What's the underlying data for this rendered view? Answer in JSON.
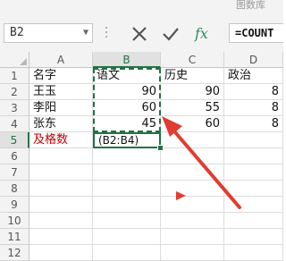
{
  "watermark": "图数库",
  "formula_bar": {
    "name_box": "B2",
    "cancel_icon": "cancel-icon",
    "enter_icon": "check-icon",
    "function_label": "fx",
    "formula_text": "=COUNT"
  },
  "columns": [
    "A",
    "B",
    "C",
    "D"
  ],
  "rows": [
    "1",
    "2",
    "3",
    "4",
    "5",
    "6",
    "7",
    "8",
    "9",
    "10",
    "11",
    "12"
  ],
  "table": {
    "headers": [
      "名字",
      "语文",
      "历史",
      "政治"
    ],
    "records": [
      {
        "name": "王玉",
        "chinese": "90",
        "history": "90",
        "politics": "8"
      },
      {
        "name": "李阳",
        "chinese": "60",
        "history": "55",
        "politics": "8"
      },
      {
        "name": "张东",
        "chinese": "45",
        "history": "60",
        "politics": "8"
      }
    ],
    "summary_label": "及格数",
    "editing_cell": "(B2:B4)"
  },
  "colors": {
    "accent": "#217346",
    "arrow": "#e03c31",
    "summary_text": "#c00000"
  }
}
